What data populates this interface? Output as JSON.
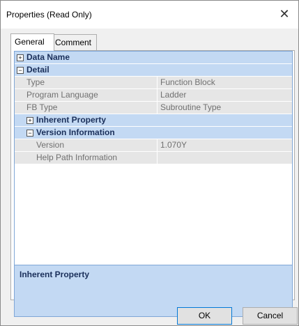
{
  "window": {
    "title": "Properties (Read Only)",
    "close_glyph": "✕"
  },
  "tabs": [
    {
      "label": "General",
      "active": true
    },
    {
      "label": "Comment",
      "active": false
    }
  ],
  "grid": {
    "data_name": {
      "label": "Data Name",
      "toggle": "+"
    },
    "detail": {
      "label": "Detail",
      "toggle": "−",
      "items": [
        {
          "label": "Type",
          "value": "Function Block"
        },
        {
          "label": "Program Language",
          "value": "Ladder"
        },
        {
          "label": "FB Type",
          "value": "Subroutine Type"
        }
      ]
    },
    "inherent_property": {
      "label": "Inherent Property",
      "toggle": "+"
    },
    "version_information": {
      "label": "Version Information",
      "toggle": "−",
      "items": [
        {
          "label": "Version",
          "value": "1.070Y"
        },
        {
          "label": "Help Path Information",
          "value": ""
        }
      ]
    }
  },
  "description": {
    "title": "Inherent Property"
  },
  "buttons": {
    "ok": "OK",
    "cancel": "Cancel"
  },
  "colors": {
    "category_bg": "#c3d9f3",
    "item_bg": "#e6e6e6",
    "border_blue": "#7fa6d6"
  }
}
